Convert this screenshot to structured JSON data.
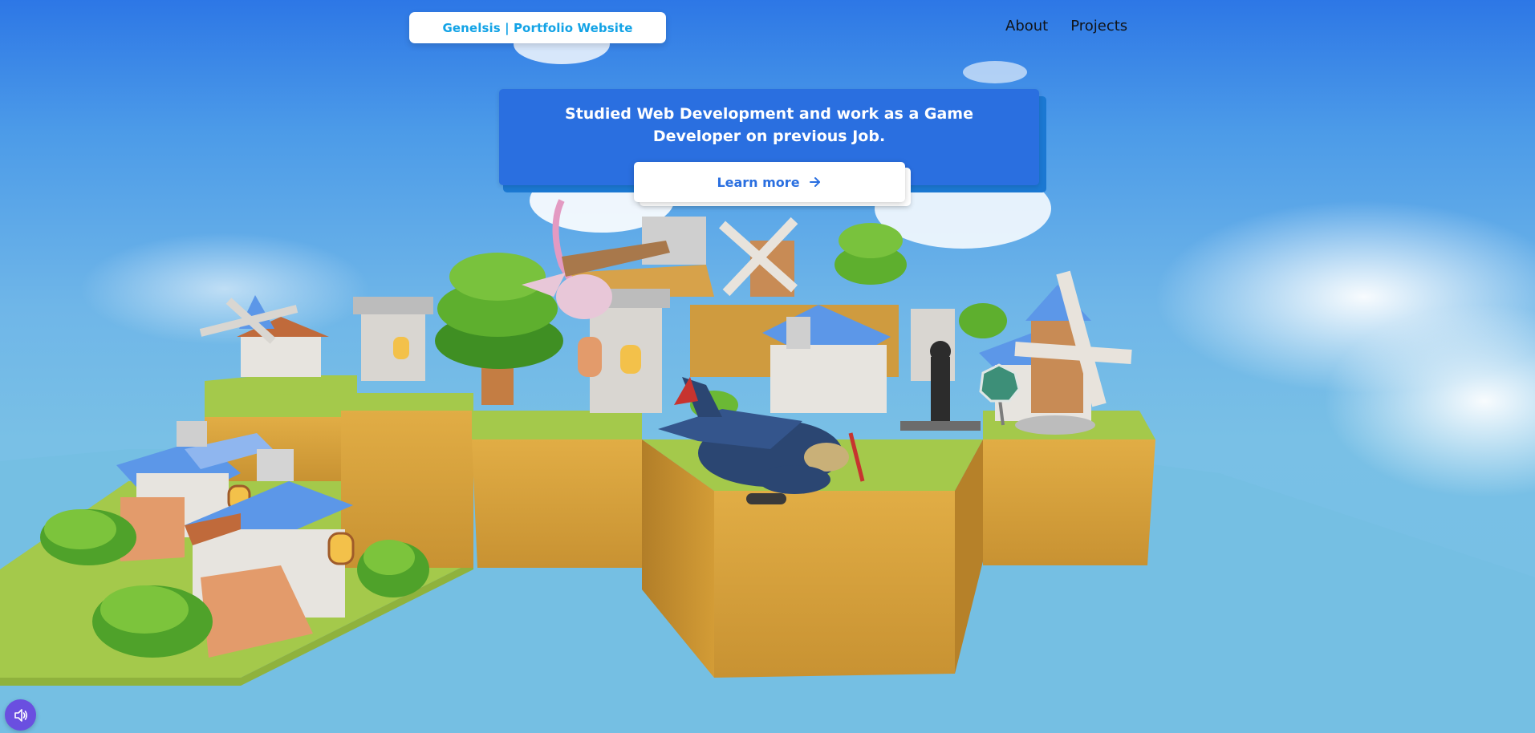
{
  "brand": {
    "label": "Genelsis | Portfolio Website"
  },
  "nav": {
    "items": [
      {
        "label": "About"
      },
      {
        "label": "Projects"
      }
    ]
  },
  "hero": {
    "message": "Studied Web Development and work as a Game Developer on previous Job.",
    "cta_label": "Learn more",
    "cta_icon": "arrow-right-icon"
  },
  "scene": {
    "description_icon": "floating-island-3d-scene",
    "elements": [
      "windmill",
      "house",
      "tower",
      "tree",
      "airplane",
      "flying-creature",
      "stop-sign",
      "character"
    ]
  },
  "sound": {
    "icon": "speaker-icon"
  },
  "colors": {
    "sky_top": "#2d77e6",
    "sky_bottom": "#79c0e6",
    "card_blue": "#2a6fe0",
    "brand_cyan": "#13a3e6",
    "sound_purple": "#6a4fe0",
    "grass": "#a4c94b",
    "dirt": "#d9a43c"
  }
}
